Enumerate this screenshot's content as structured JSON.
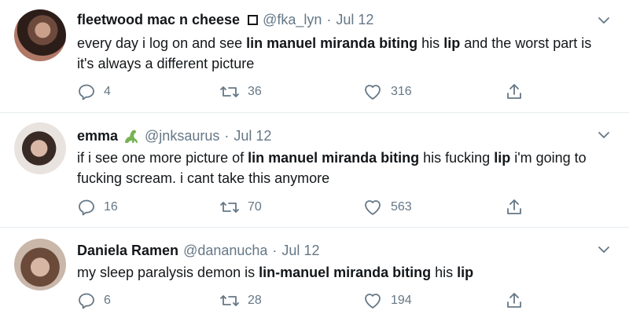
{
  "tweets": [
    {
      "name": "fleetwood mac n cheese",
      "badge": "□",
      "handle": "@fka_lyn",
      "dot": "·",
      "date": "Jul 12",
      "text_parts": [
        {
          "t": "every day i log on and see ",
          "b": false
        },
        {
          "t": "lin manuel miranda biting",
          "b": true
        },
        {
          "t": " his ",
          "b": false
        },
        {
          "t": "lip",
          "b": true
        },
        {
          "t": " and the worst part is it's always a different picture",
          "b": false
        }
      ],
      "replies": "4",
      "retweets": "36",
      "likes": "316"
    },
    {
      "name": "emma",
      "emoji": "dinosaur-icon",
      "handle": "@jnksaurus",
      "dot": "·",
      "date": "Jul 12",
      "text_parts": [
        {
          "t": "if i see one more picture of ",
          "b": false
        },
        {
          "t": "lin manuel miranda biting",
          "b": true
        },
        {
          "t": " his fucking ",
          "b": false
        },
        {
          "t": "lip",
          "b": true
        },
        {
          "t": " i'm going to fucking scream. i cant take this anymore",
          "b": false
        }
      ],
      "replies": "16",
      "retweets": "70",
      "likes": "563"
    },
    {
      "name": "Daniela Ramen",
      "handle": "@dananucha",
      "dot": "·",
      "date": "Jul 12",
      "text_parts": [
        {
          "t": "my sleep paralysis demon is ",
          "b": false
        },
        {
          "t": "lin-manuel miranda biting",
          "b": true
        },
        {
          "t": " his ",
          "b": false
        },
        {
          "t": "lip",
          "b": true
        }
      ],
      "replies": "6",
      "retweets": "28",
      "likes": "194"
    }
  ],
  "colors": {
    "text": "#14171a",
    "secondary": "#657786",
    "divider": "#e6ecf0",
    "dino": "#77b255"
  },
  "icons": [
    "reply-icon",
    "retweet-icon",
    "like-icon",
    "share-icon",
    "caret-down-icon"
  ]
}
